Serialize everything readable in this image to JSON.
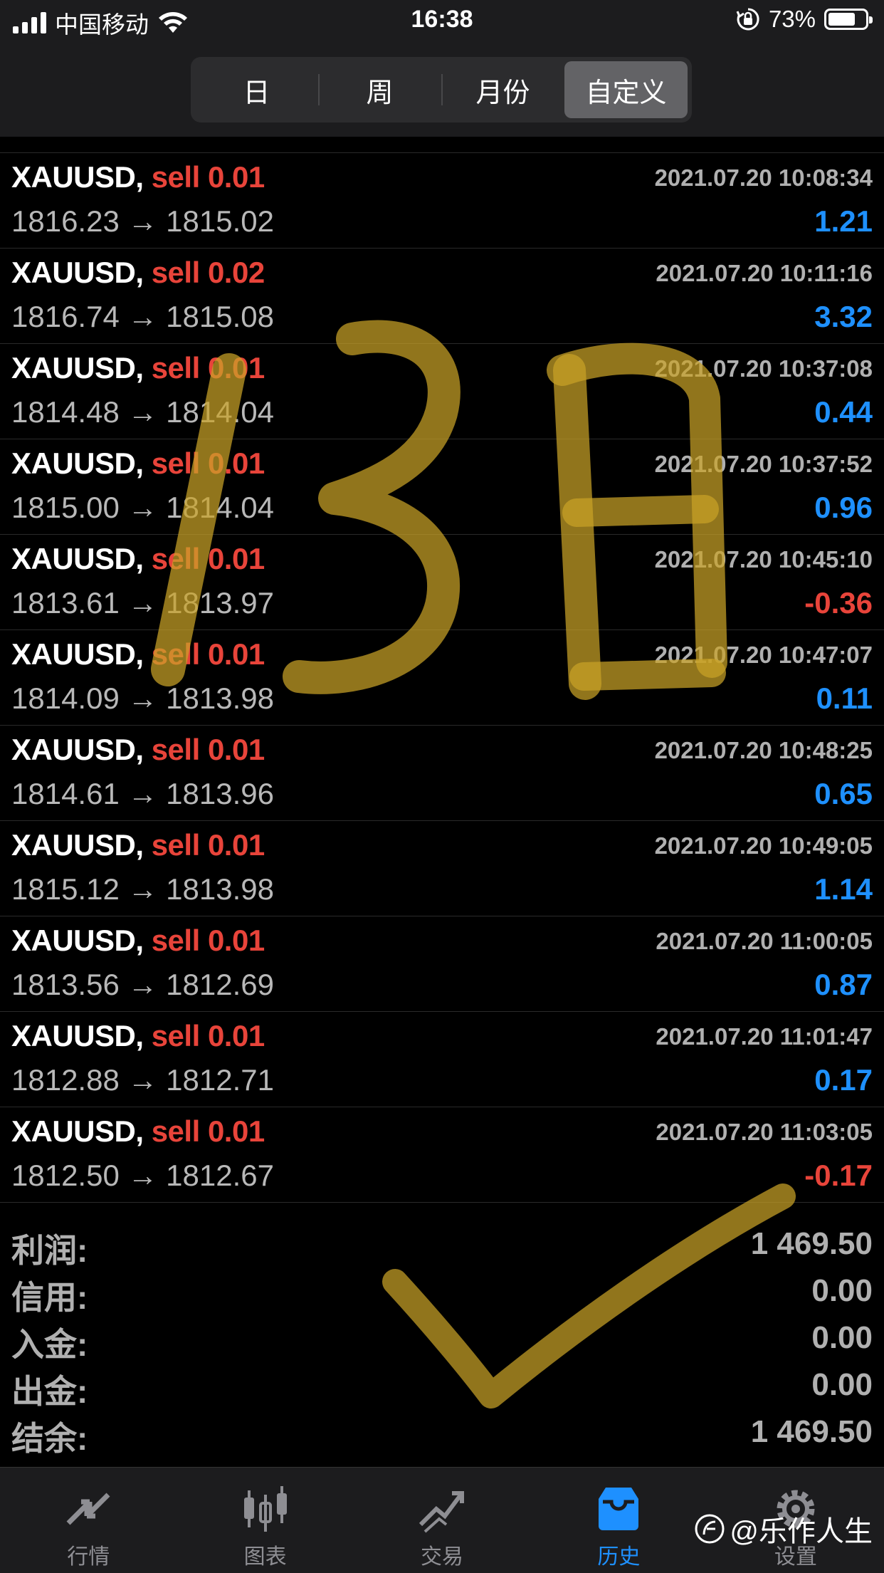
{
  "status_bar": {
    "carrier": "中国移动",
    "time": "16:38",
    "battery_text": "73%",
    "battery_level": 0.73
  },
  "header": {
    "segments": [
      {
        "label": "日",
        "active": false
      },
      {
        "label": "周",
        "active": false
      },
      {
        "label": "月份",
        "active": false
      },
      {
        "label": "自定义",
        "active": true
      }
    ]
  },
  "trades": [
    {
      "symbol": "XAUUSD,",
      "side": "sell",
      "volume": "0.01",
      "time": "2021.07.20 10:08:34",
      "open": "1816.23",
      "close": "1815.02",
      "profit": "1.21"
    },
    {
      "symbol": "XAUUSD,",
      "side": "sell",
      "volume": "0.02",
      "time": "2021.07.20 10:11:16",
      "open": "1816.74",
      "close": "1815.08",
      "profit": "3.32"
    },
    {
      "symbol": "XAUUSD,",
      "side": "sell",
      "volume": "0.01",
      "time": "2021.07.20 10:37:08",
      "open": "1814.48",
      "close": "1814.04",
      "profit": "0.44"
    },
    {
      "symbol": "XAUUSD,",
      "side": "sell",
      "volume": "0.01",
      "time": "2021.07.20 10:37:52",
      "open": "1815.00",
      "close": "1814.04",
      "profit": "0.96"
    },
    {
      "symbol": "XAUUSD,",
      "side": "sell",
      "volume": "0.01",
      "time": "2021.07.20 10:45:10",
      "open": "1813.61",
      "close": "1813.97",
      "profit": "-0.36"
    },
    {
      "symbol": "XAUUSD,",
      "side": "sell",
      "volume": "0.01",
      "time": "2021.07.20 10:47:07",
      "open": "1814.09",
      "close": "1813.98",
      "profit": "0.11"
    },
    {
      "symbol": "XAUUSD,",
      "side": "sell",
      "volume": "0.01",
      "time": "2021.07.20 10:48:25",
      "open": "1814.61",
      "close": "1813.96",
      "profit": "0.65"
    },
    {
      "symbol": "XAUUSD,",
      "side": "sell",
      "volume": "0.01",
      "time": "2021.07.20 10:49:05",
      "open": "1815.12",
      "close": "1813.98",
      "profit": "1.14"
    },
    {
      "symbol": "XAUUSD,",
      "side": "sell",
      "volume": "0.01",
      "time": "2021.07.20 11:00:05",
      "open": "1813.56",
      "close": "1812.69",
      "profit": "0.87"
    },
    {
      "symbol": "XAUUSD,",
      "side": "sell",
      "volume": "0.01",
      "time": "2021.07.20 11:01:47",
      "open": "1812.88",
      "close": "1812.71",
      "profit": "0.17"
    },
    {
      "symbol": "XAUUSD,",
      "side": "sell",
      "volume": "0.01",
      "time": "2021.07.20 11:03:05",
      "open": "1812.50",
      "close": "1812.67",
      "profit": "-0.17"
    }
  ],
  "arrow": "→",
  "summary": [
    {
      "label": "利润:",
      "value": "1 469.50"
    },
    {
      "label": "信用:",
      "value": "0.00"
    },
    {
      "label": "入金:",
      "value": "0.00"
    },
    {
      "label": "出金:",
      "value": "0.00"
    },
    {
      "label": "结余:",
      "value": "1 469.50"
    }
  ],
  "tabs": [
    {
      "label": "行情",
      "icon": "quotes-icon",
      "active": false
    },
    {
      "label": "图表",
      "icon": "chart-icon",
      "active": false
    },
    {
      "label": "交易",
      "icon": "trade-icon",
      "active": false
    },
    {
      "label": "历史",
      "icon": "history-icon",
      "active": true
    },
    {
      "label": "设置",
      "icon": "settings-icon",
      "active": false
    }
  ],
  "watermark": {
    "text": "@乐作人生"
  },
  "colors": {
    "profit_positive": "#1e90ff",
    "profit_negative": "#e8443a",
    "side_sell": "#e8443a",
    "tab_active": "#1e90ff",
    "handwriting": "#c9a227"
  }
}
